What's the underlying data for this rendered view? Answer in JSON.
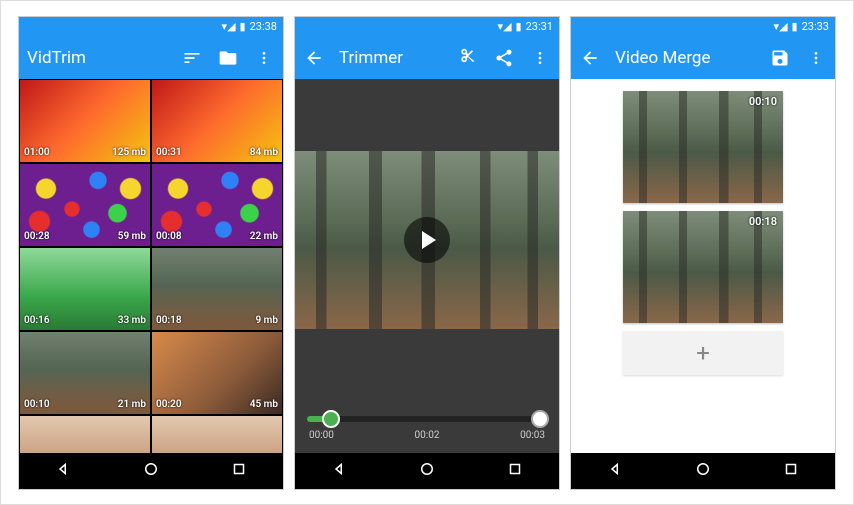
{
  "screens": [
    {
      "status_time": "23:38",
      "title": "VidTrim",
      "grid": [
        {
          "duration": "01:00",
          "size": "125 mb"
        },
        {
          "duration": "00:31",
          "size": "84 mb"
        },
        {
          "duration": "00:28",
          "size": "59 mb"
        },
        {
          "duration": "00:08",
          "size": "22 mb"
        },
        {
          "duration": "00:16",
          "size": "33 mb"
        },
        {
          "duration": "00:18",
          "size": "9 mb"
        },
        {
          "duration": "00:10",
          "size": "21 mb"
        },
        {
          "duration": "00:20",
          "size": "45 mb"
        }
      ]
    },
    {
      "status_time": "23:31",
      "title": "Trimmer",
      "timeline": {
        "start": "00:00",
        "mid": "00:02",
        "end": "00:03"
      }
    },
    {
      "status_time": "23:33",
      "title": "Video Merge",
      "clips": [
        {
          "duration": "00:10"
        },
        {
          "duration": "00:18"
        }
      ],
      "add_label": "+"
    }
  ]
}
